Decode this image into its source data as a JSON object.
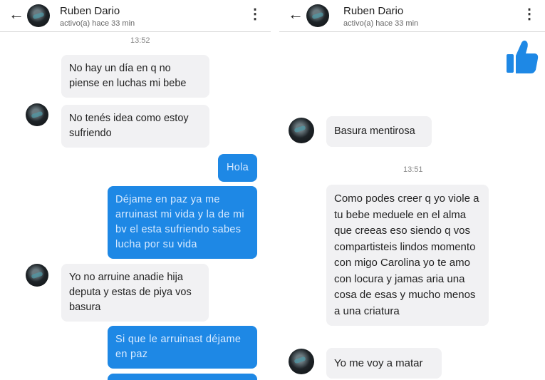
{
  "left": {
    "header": {
      "name": "Ruben Dario",
      "status": "activo(a) hace 33 min"
    },
    "timestamp": "13:52",
    "messages": [
      {
        "text": "No hay un día en q no piense en luchas mi bebe"
      },
      {
        "text": "No tenés idea como estoy sufriendo"
      },
      {
        "text": "Hola"
      },
      {
        "text": "Déjame en paz ya me arruinast mi vida y la de mi bv el esta sufriendo sabes lucha por su vida"
      },
      {
        "text": "Yo no arruine anadie hija deputa y estas de piya vos basura"
      },
      {
        "text": "Si que le arruinast déjame en paz"
      }
    ]
  },
  "right": {
    "header": {
      "name": "Ruben Dario",
      "status": "activo(a) hace 33 min"
    },
    "timestamp": "13:51",
    "messages": [
      {
        "text": "Basura mentirosa"
      },
      {
        "text": "Como podes creer q yo viole a tu bebe meduele en el alma que creeas eso siendo q vos compartisteis lindos  momento con migo Carolina yo te amo con locura y jamas aria una cosa de esas y mucho menos a una criatura"
      },
      {
        "text": "Yo me voy a matar"
      }
    ]
  },
  "colors": {
    "outgoing_bubble": "#1e88e5",
    "incoming_bubble": "#f1f1f3",
    "like": "#1e88e5"
  }
}
